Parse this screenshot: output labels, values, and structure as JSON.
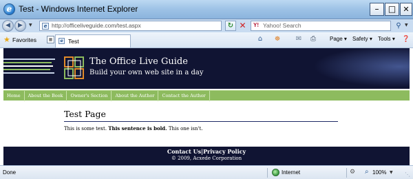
{
  "window": {
    "title": "Test - Windows Internet Explorer",
    "min_label": "–",
    "max_label": "□",
    "close_label": "✕"
  },
  "address_bar": {
    "url": "http://officeliveguide.com/test.aspx",
    "search_placeholder": "Yahoo! Search",
    "search_logo": "Y!"
  },
  "favorites_bar": {
    "favorites_label": "Favorites",
    "tab_label": "Test",
    "page_menu": "Page ▾",
    "safety_menu": "Safety ▾",
    "tools_menu": "Tools ▾",
    "help_icon": "❓"
  },
  "site": {
    "title": "The Office Live Guide",
    "subtitle": "Build your own web site in a day",
    "nav": [
      "Home",
      "About the Book",
      "Owner's Section",
      "About the Author",
      "Contact the Author"
    ],
    "page_title": "Test Page",
    "paragraph": {
      "normal_1": "This is some text. ",
      "bold": "This sentence is bold.",
      "normal_2": " This one isn't."
    },
    "footer": {
      "contact": "Contact Us",
      "divider": "|",
      "privacy": "Privacy Policy",
      "copyright": "© 2009, Acxede Corporation"
    },
    "colors": {
      "header_bg": "#101433",
      "nav_bg": "#8dbb5e",
      "rule": "#1d2a66"
    }
  },
  "status_bar": {
    "status": "Done",
    "zone": "Internet",
    "zoom": "100%"
  },
  "icons": {
    "ie_logo": "ie-logo-icon",
    "back": "back-arrow-icon",
    "forward": "forward-arrow-icon",
    "refresh": "refresh-icon",
    "stop": "stop-icon",
    "search": "magnifier-icon",
    "favorites": "star-icon",
    "home": "home-icon",
    "feeds": "rss-icon",
    "mail": "mail-icon",
    "print": "printer-icon",
    "zone": "globe-icon",
    "zoom": "zoom-icon"
  }
}
